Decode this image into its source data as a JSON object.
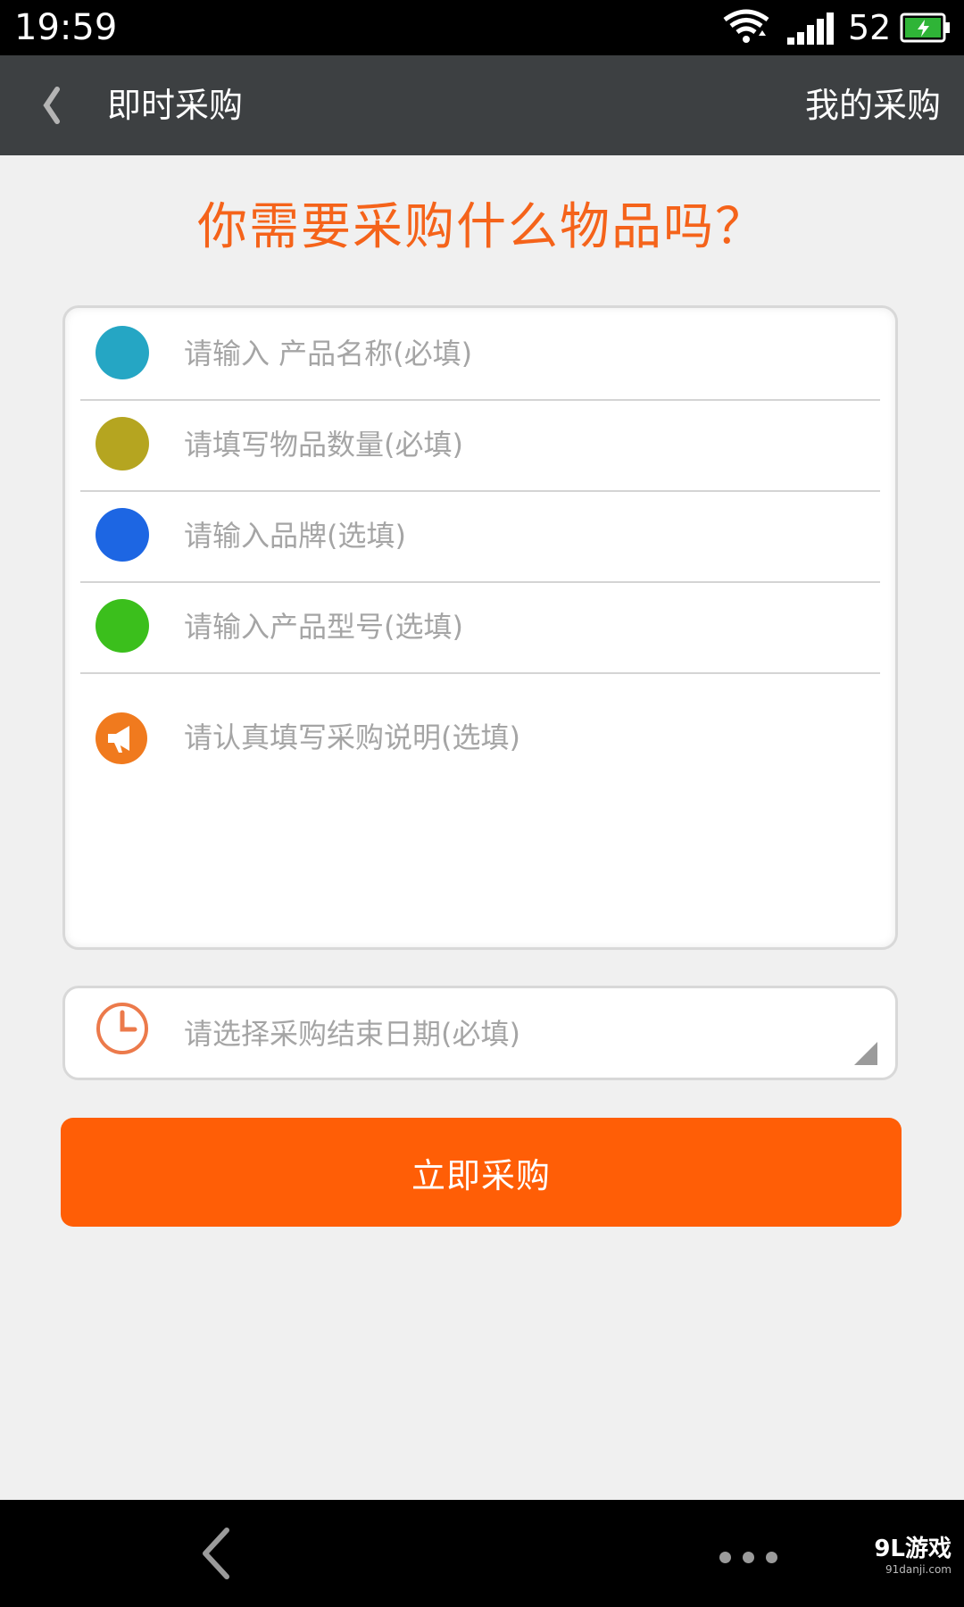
{
  "status_bar": {
    "time": "19:59",
    "battery_level": "52"
  },
  "header": {
    "title": "即时采购",
    "my_purchases": "我的采购"
  },
  "headline": "你需要采购什么物品吗？",
  "form": {
    "fields": [
      {
        "placeholder": "请输入 产品名称(必填)",
        "value": "",
        "dot_color": "#25a6c4"
      },
      {
        "placeholder": "请填写物品数量(必填)",
        "value": "",
        "dot_color": "#b5a520"
      },
      {
        "placeholder": "请输入品牌(选填)",
        "value": "",
        "dot_color": "#1d66e3"
      },
      {
        "placeholder": "请输入产品型号(选填)",
        "value": "",
        "dot_color": "#3bbf1c"
      }
    ],
    "notes_placeholder": "请认真填写采购说明(选填)",
    "notes_icon_color": "#f07a1e",
    "date_placeholder": "请选择采购结束日期(必填)",
    "submit_label": "立即采购"
  },
  "watermark": {
    "main": "9L游戏",
    "sub": "91danji.com"
  },
  "colors": {
    "accent": "#ff5e06",
    "header_bg": "#3d4042",
    "headline": "#f5631a"
  }
}
